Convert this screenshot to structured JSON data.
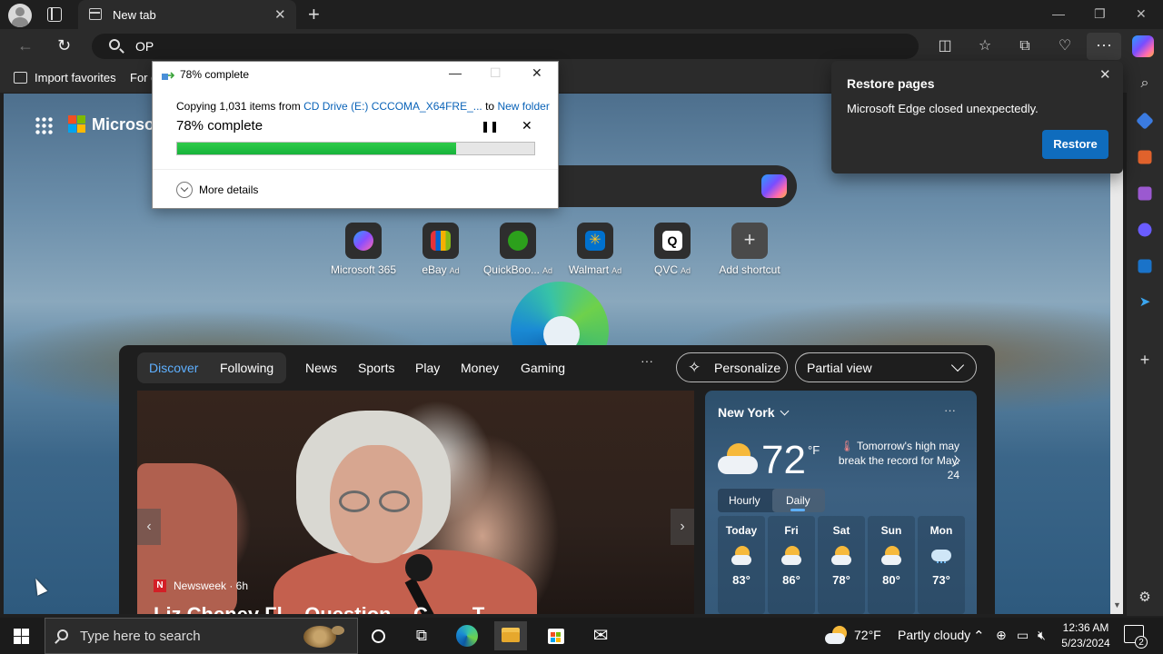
{
  "browser": {
    "tab_title": "New tab",
    "address_text": "OP",
    "favorites": {
      "import_label": "Import favorites",
      "for_label": "For q"
    }
  },
  "newtab": {
    "brand": "Microsoft",
    "shortcuts": [
      {
        "label": "Microsoft 365",
        "ad": "",
        "icon": "m365-icon",
        "color": "#6a5cff"
      },
      {
        "label": "eBay",
        "ad": "Ad",
        "icon": "ebay-icon",
        "color": "#e53238"
      },
      {
        "label": "QuickBoo...",
        "ad": "Ad",
        "icon": "quickbooks-icon",
        "color": "#2ca01c"
      },
      {
        "label": "Walmart",
        "ad": "Ad",
        "icon": "walmart-icon",
        "color": "#0071ce"
      },
      {
        "label": "QVC",
        "ad": "Ad",
        "icon": "qvc-icon",
        "color": "#ffffff"
      },
      {
        "label": "Add shortcut",
        "ad": "",
        "icon": "plus-icon",
        "color": "#555555"
      }
    ]
  },
  "feed": {
    "tabs": [
      "Discover",
      "Following",
      "News",
      "Sports",
      "Play",
      "Money",
      "Gaming"
    ],
    "more": "···",
    "personalize": "Personalize",
    "view": "Partial view",
    "news": {
      "source": "Newsweek · 6h",
      "headline": "Liz Cheney Fl... Question... C... ... T..."
    },
    "weather": {
      "city": "New York",
      "temp": "72",
      "unit": "°F",
      "alert": "Tomorrow's high may break the record for May. 24",
      "hourly": "Hourly",
      "daily": "Daily",
      "days": [
        {
          "name": "Today",
          "high": "83°"
        },
        {
          "name": "Fri",
          "high": "86°"
        },
        {
          "name": "Sat",
          "high": "78°"
        },
        {
          "name": "Sun",
          "high": "80°"
        },
        {
          "name": "Mon",
          "high": "73°"
        }
      ]
    }
  },
  "copy_dialog": {
    "title": "78% complete",
    "copying_prefix": "Copying 1,031 items from ",
    "source": "CD Drive (E:) CCCOMA_X64FRE_...",
    "to_word": " to ",
    "destination": "New folder",
    "percent_text": "78% complete",
    "progress": 0.78,
    "more_details": "More details"
  },
  "toast": {
    "title": "Restore pages",
    "message": "Microsoft Edge closed unexpectedly.",
    "button": "Restore"
  },
  "taskbar": {
    "search_placeholder": "Type here to search",
    "weather_temp": "72°F",
    "weather_desc": "Partly cloudy",
    "time": "12:36 AM",
    "date": "5/23/2024",
    "notifications": "2"
  },
  "colors": {
    "accent": "#0f6cbd",
    "progress": "#17b33b",
    "link": "#0a63b8",
    "feed_active": "#5eb0ff"
  }
}
